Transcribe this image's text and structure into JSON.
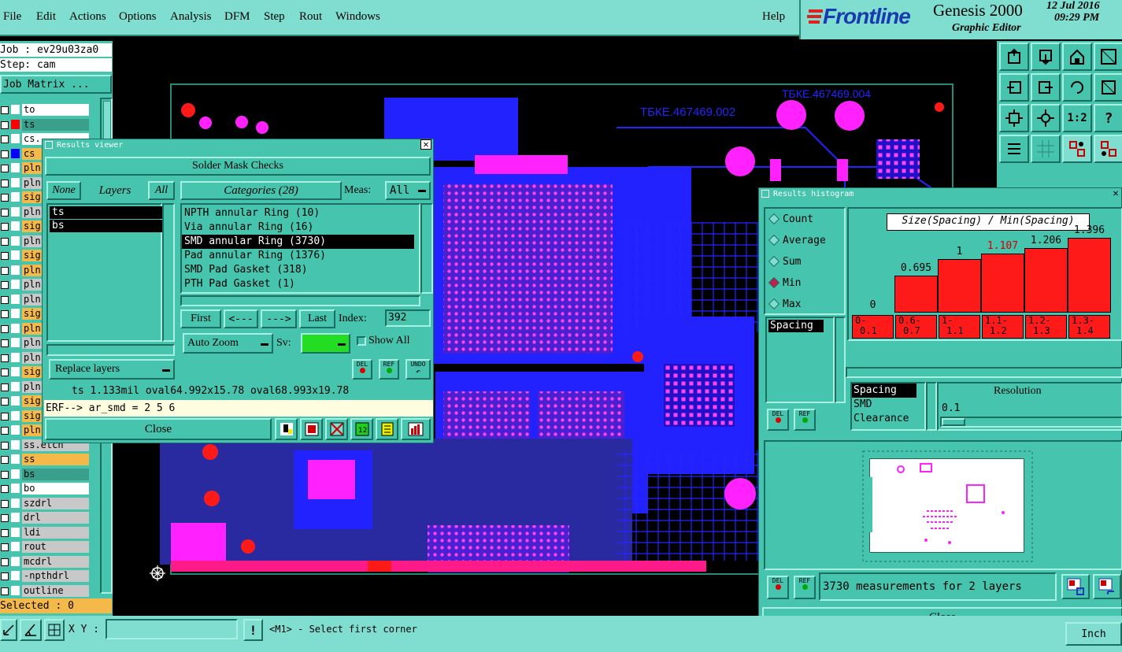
{
  "menu": [
    "File",
    "Edit",
    "Actions",
    "Options",
    "Analysis",
    "DFM",
    "Step",
    "Rout",
    "Windows"
  ],
  "help": "Help",
  "brand": {
    "logo": "Frontline",
    "product": "Genesis 2000",
    "subtitle": "Graphic Editor",
    "date": "12 Jul 2016",
    "time": "09:29 PM"
  },
  "job": {
    "job_label": "Job : ev29u03za0",
    "step_label": "Step: cam",
    "matrix_button": "Job Matrix ..."
  },
  "layers": [
    {
      "name": "to",
      "color": "#ffffff",
      "sw": "#ffffff"
    },
    {
      "name": "ts",
      "color": "#3aa08c",
      "sw": "#ff0000"
    },
    {
      "name": "cs.",
      "color": "#ffffff",
      "sw": "#ffffff"
    },
    {
      "name": "cs",
      "color": "#f5b94a",
      "sw": "#0000ff"
    },
    {
      "name": "pln",
      "color": "#f5b94a",
      "sw": "#ffffff"
    },
    {
      "name": "pln",
      "color": "#c8c8c8",
      "sw": "#ffffff"
    },
    {
      "name": "sig",
      "color": "#f5b94a",
      "sw": "#ffffff"
    },
    {
      "name": "pln",
      "color": "#c8c8c8",
      "sw": "#ffffff"
    },
    {
      "name": "sig",
      "color": "#f5b94a",
      "sw": "#ffffff"
    },
    {
      "name": "pln",
      "color": "#c8c8c8",
      "sw": "#ffffff"
    },
    {
      "name": "sig",
      "color": "#f5b94a",
      "sw": "#ffffff"
    },
    {
      "name": "pln",
      "color": "#f5b94a",
      "sw": "#ffffff"
    },
    {
      "name": "pln",
      "color": "#c8c8c8",
      "sw": "#ffffff"
    },
    {
      "name": "pln",
      "color": "#c8c8c8",
      "sw": "#ffffff"
    },
    {
      "name": "sig",
      "color": "#f5b94a",
      "sw": "#ffffff"
    },
    {
      "name": "pln",
      "color": "#f5b94a",
      "sw": "#ffffff"
    },
    {
      "name": "pln",
      "color": "#c8c8c8",
      "sw": "#ffffff"
    },
    {
      "name": "pln",
      "color": "#c8c8c8",
      "sw": "#ffffff"
    },
    {
      "name": "sig",
      "color": "#f5b94a",
      "sw": "#ffffff"
    },
    {
      "name": "pln",
      "color": "#c8c8c8",
      "sw": "#ffffff"
    },
    {
      "name": "sig",
      "color": "#f5b94a",
      "sw": "#ffffff"
    },
    {
      "name": "sig",
      "color": "#f5b94a",
      "sw": "#ffffff"
    },
    {
      "name": "pln",
      "color": "#f5b94a",
      "sw": "#ffffff"
    },
    {
      "name": "ss.etch",
      "color": "#c8c8c8",
      "sw": "#ffffff"
    },
    {
      "name": "ss",
      "color": "#f5b94a",
      "sw": "#ffffff"
    },
    {
      "name": "bs",
      "color": "#3aa08c",
      "sw": "#ffffff"
    },
    {
      "name": "bo",
      "color": "#ffffff",
      "sw": "#ffffff"
    },
    {
      "name": "szdrl",
      "color": "#c8c8c8",
      "sw": "#ffffff"
    },
    {
      "name": "drl",
      "color": "#c8c8c8",
      "sw": "#ffffff"
    },
    {
      "name": "ldi",
      "color": "#c8c8c8",
      "sw": "#ffffff"
    },
    {
      "name": "rout",
      "color": "#c8c8c8",
      "sw": "#ffffff"
    },
    {
      "name": "mcdrl",
      "color": "#c8c8c8",
      "sw": "#ffffff"
    },
    {
      "name": "-npthdrl",
      "color": "#c8c8c8",
      "sw": "#ffffff"
    },
    {
      "name": "outline",
      "color": "#c8c8c8",
      "sw": "#ffffff"
    }
  ],
  "selected": "Selected : 0",
  "status": {
    "xy_label": "X Y :",
    "xy_value": "",
    "prompt": "<M1> - Select first corner",
    "right_btn": "Inch"
  },
  "pcb": {
    "label_a": "ТБКЕ.467469.002",
    "label_b": "ТБКЕ.467469.004"
  },
  "results_viewer": {
    "title": "Results viewer",
    "header": "Solder Mask Checks",
    "none": "None",
    "layers_label": "Layers",
    "all": "All",
    "categories_label": "Categories (28)",
    "meas_label": "Meas:",
    "meas_value": "All",
    "layer_list": [
      "ts",
      "bs"
    ],
    "categories": [
      "NPTH annular Ring (10)",
      "Via annular Ring (16)",
      "SMD annular Ring (3730)",
      "Pad annular Ring (1376)",
      "SMD Pad Gasket (318)",
      "PTH Pad Gasket (1)"
    ],
    "selected_category": "SMD annular Ring (3730)",
    "nav": {
      "first": "First",
      "prev": "<---",
      "next": "--->",
      "last": "Last",
      "index_label": "Index:",
      "index_value": "392"
    },
    "auto_zoom": "Auto Zoom",
    "sv_label": "Sv:",
    "show_all": "Show All",
    "replace_layers": "Replace layers",
    "del": "DEL",
    "ref": "REF",
    "undo": "UNDO",
    "info": "ts 1.133mil  oval64.992x15.78  oval68.993x19.78",
    "erf": "ERF--> ar_smd = 2 5 6",
    "close": "Close"
  },
  "histogram": {
    "title": "Results histogram",
    "options": [
      "Count",
      "Average",
      "Sum",
      "Min",
      "Max"
    ],
    "selected_option": "Min",
    "chart_title": "Size(Spacing) / Min(Spacing)",
    "list_a": [
      "Spacing"
    ],
    "list_b": [
      "Spacing",
      "SMD",
      "Clearance"
    ],
    "resolution_label": "Resolution",
    "resolution_value": "0.1",
    "summary": "3730 measurements for 2 layers",
    "del": "DEL",
    "ref": "REF",
    "close": "Close"
  },
  "chart_data": {
    "type": "bar",
    "title": "Size(Spacing) / Min(Spacing)",
    "categories": [
      "0-0.1",
      "0.6-0.7",
      "1-1.1",
      "1.1-1.2",
      "1.2-1.3",
      "1.3-1.4"
    ],
    "category_labels": [
      [
        "0-",
        "0.1"
      ],
      [
        "0.6-",
        "0.7"
      ],
      [
        "1-",
        "1.1"
      ],
      [
        "1.1-",
        "1.2"
      ],
      [
        "1.2-",
        "1.3"
      ],
      [
        "1.3-",
        "1.4"
      ]
    ],
    "value_labels": [
      "0",
      "0.695",
      "1",
      "1.107",
      "1.206",
      "1.396"
    ],
    "values": [
      0,
      0.695,
      1,
      1.107,
      1.206,
      1.396
    ],
    "highlight_index": 3,
    "colors": {
      "bar": "#ff1a1a",
      "highlight_text": "#cc0000"
    }
  }
}
